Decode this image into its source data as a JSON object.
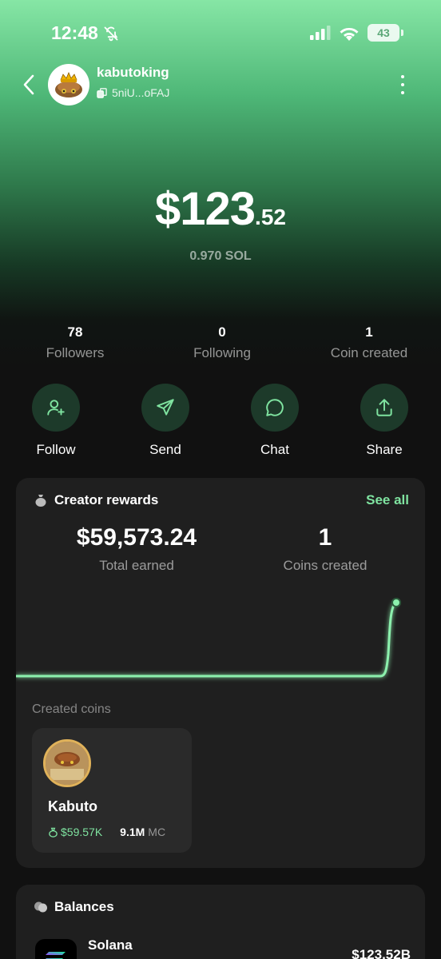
{
  "status_bar": {
    "time": "12:48",
    "battery": "43"
  },
  "profile": {
    "username": "kabutoking",
    "address": "5niU...oFAJ"
  },
  "balance": {
    "dollars": "$123",
    "cents": ".52",
    "sol": "0.970 SOL"
  },
  "stats": [
    {
      "value": "78",
      "label": "Followers"
    },
    {
      "value": "0",
      "label": "Following"
    },
    {
      "value": "1",
      "label": "Coin created"
    }
  ],
  "actions": [
    {
      "label": "Follow",
      "icon": "user-plus-icon"
    },
    {
      "label": "Send",
      "icon": "send-icon"
    },
    {
      "label": "Chat",
      "icon": "chat-icon"
    },
    {
      "label": "Share",
      "icon": "share-icon"
    }
  ],
  "creator_rewards": {
    "title": "Creator rewards",
    "see_all": "See all",
    "total_earned_value": "$59,573.24",
    "total_earned_label": "Total earned",
    "coins_created_value": "1",
    "coins_created_label": "Coins created",
    "created_coins_label": "Created coins",
    "coin": {
      "name": "Kabuto",
      "earned": "$59.57K",
      "mc_value": "9.1M",
      "mc_unit": "MC"
    }
  },
  "balances": {
    "title": "Balances",
    "tokens": [
      {
        "name": "Solana",
        "value": "$123.52B"
      }
    ]
  },
  "colors": {
    "accent": "#7fe3a0",
    "card": "#1f1f1f",
    "background": "#111111"
  }
}
